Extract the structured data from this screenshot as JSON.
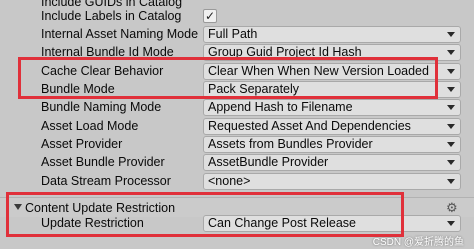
{
  "rows": [
    {
      "label": "Include GUIDs in Catalog",
      "type": "checkbox"
    },
    {
      "label": "Include Labels in Catalog",
      "type": "checkbox"
    },
    {
      "label": "Internal Asset Naming Mode",
      "value": "Full Path"
    },
    {
      "label": "Internal Bundle Id Mode",
      "value": "Group Guid Project Id Hash"
    },
    {
      "label": "Cache Clear Behavior",
      "value": "Clear When When New Version Loaded"
    },
    {
      "label": "Bundle Mode",
      "value": "Pack Separately"
    },
    {
      "label": "Bundle Naming Mode",
      "value": "Append Hash to Filename"
    },
    {
      "label": "Asset Load Mode",
      "value": "Requested Asset And Dependencies"
    },
    {
      "label": "Asset Provider",
      "value": "Assets from Bundles Provider"
    },
    {
      "label": "Asset Bundle Provider",
      "value": "AssetBundle Provider"
    },
    {
      "label": "Data Stream Processor",
      "value": "<none>"
    }
  ],
  "section": {
    "title": "Content Update Restriction",
    "rows": [
      {
        "label": "Update Restriction",
        "value": "Can Change Post Release"
      }
    ]
  },
  "icons": {
    "check": "✓",
    "gear": "⚙"
  },
  "watermark": "CSDN @爱折腾的鱼",
  "colors": {
    "highlight": "#e0303a",
    "background": "#c8c8c8"
  }
}
